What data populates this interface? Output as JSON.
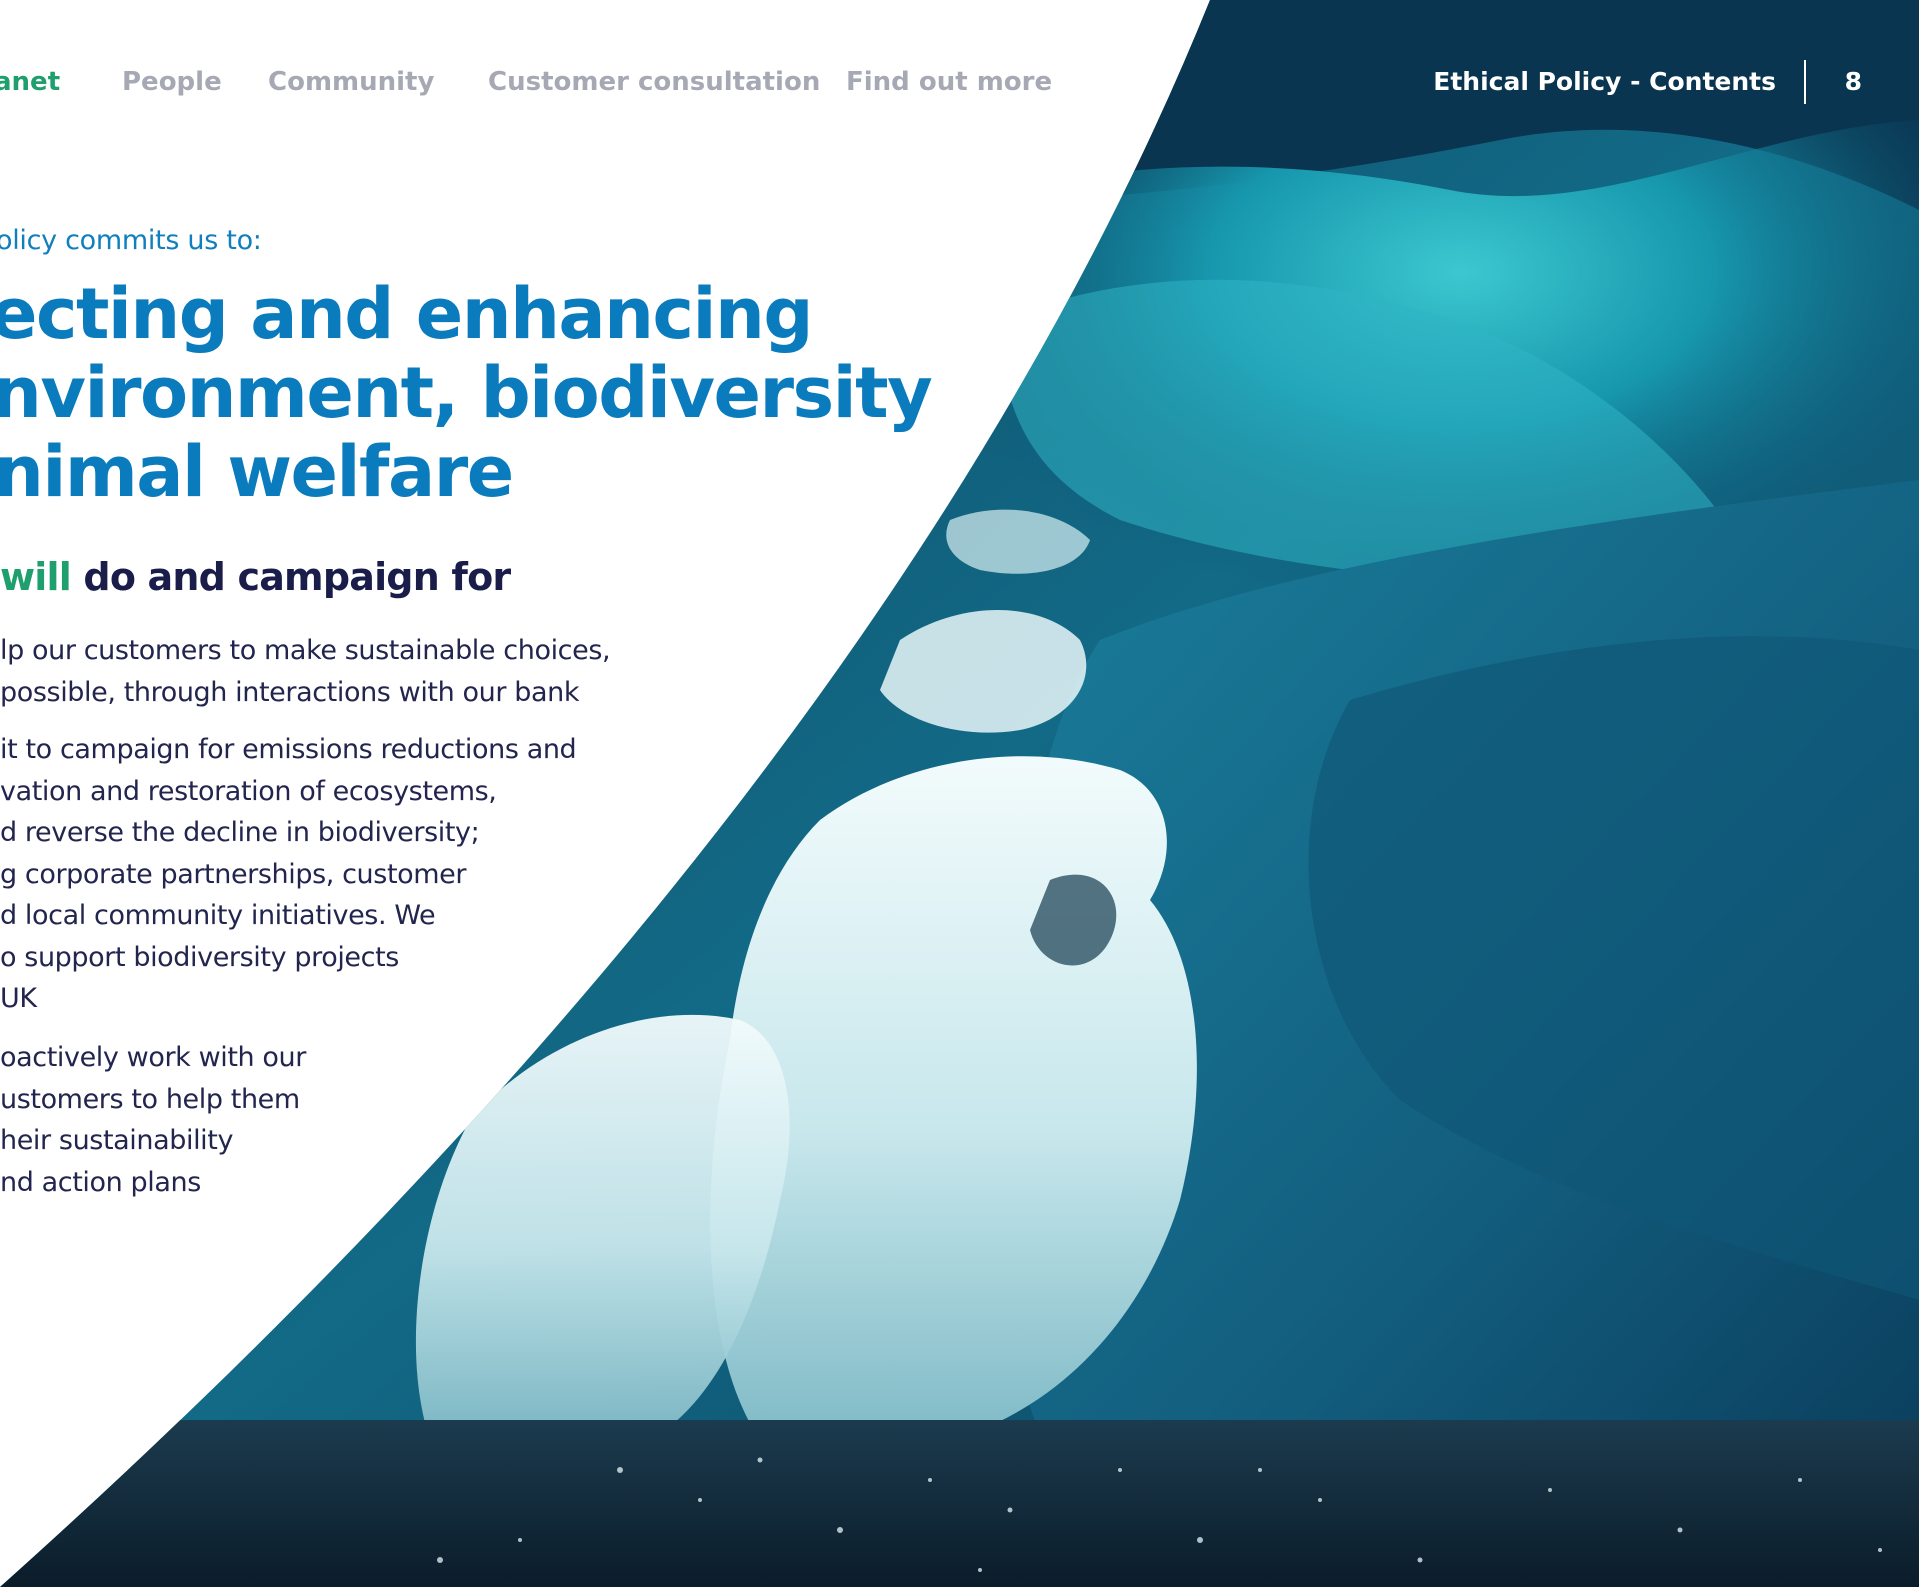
{
  "nav": {
    "items": [
      {
        "label": "anet",
        "active": true
      },
      {
        "label": "People",
        "active": false
      },
      {
        "label": "Community",
        "active": false
      },
      {
        "label": "Customer consultation",
        "active": false
      },
      {
        "label": "Find out more",
        "active": false
      }
    ]
  },
  "header": {
    "contents_link": "Ethical Policy - Contents",
    "page_number": "8"
  },
  "intro": {
    "kicker": "olicy commits us to:"
  },
  "headline": {
    "line1": "ecting and enhancing",
    "line2": "nvironment, biodiversity",
    "line3": "nimal welfare"
  },
  "subhead": {
    "accent": "will",
    "rest": " do and campaign for"
  },
  "commitments": [
    {
      "lines": [
        "lp our customers to make sustainable choices,",
        "possible, through interactions with our bank"
      ]
    },
    {
      "lines": [
        "it to campaign for emissions reductions and",
        "vation and restoration of ecosystems,",
        "d reverse the decline in biodiversity;",
        "g corporate partnerships, customer",
        "d local community initiatives. We",
        "o support biodiversity projects",
        " UK"
      ]
    },
    {
      "lines": [
        "oactively work with our",
        "ustomers to help them",
        "heir sustainability",
        "nd action plans"
      ]
    }
  ],
  "colors": {
    "brand_blue": "#0a7bbd",
    "brand_green": "#1f9e6e",
    "navy_text": "#22254e",
    "nav_grey": "#a6a8b4"
  }
}
